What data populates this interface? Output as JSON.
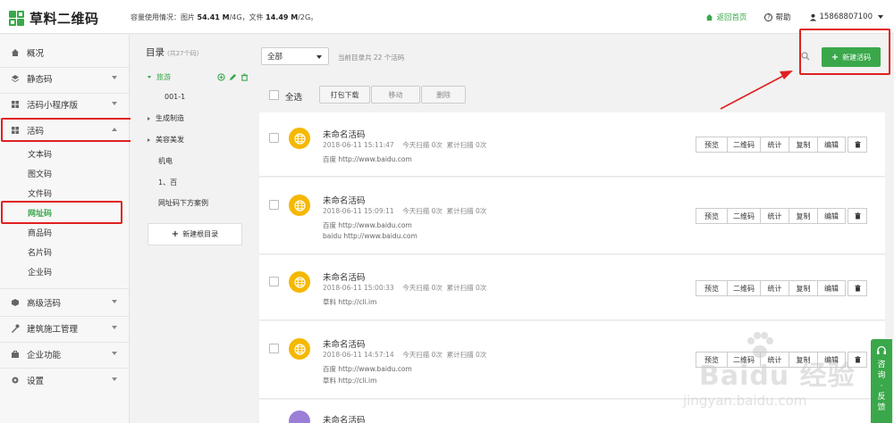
{
  "header": {
    "logo_text": "草料二维码",
    "usage_prefix": "容量使用情况：图片",
    "usage_img": "54.41 M",
    "usage_img_total": "/4G，文件",
    "usage_file": "14.49 M",
    "usage_file_total": "/2G。",
    "home_link": "返回首页",
    "help_link": "帮助",
    "user": "15868807100"
  },
  "sidebar": {
    "items": [
      {
        "label": "概况",
        "icon": "home-icon"
      },
      {
        "label": "静态码",
        "icon": "layers-icon"
      },
      {
        "label": "活码小程序版",
        "icon": "grid-icon"
      },
      {
        "label": "活码",
        "icon": "grid-icon"
      },
      {
        "label": "高级活码",
        "icon": "cube-icon"
      },
      {
        "label": "建筑施工管理",
        "icon": "tools-icon"
      },
      {
        "label": "企业功能",
        "icon": "briefcase-icon"
      },
      {
        "label": "设置",
        "icon": "gear-icon"
      }
    ],
    "sub_items": [
      "文本码",
      "图文码",
      "文件码",
      "网址码",
      "商品码",
      "名片码",
      "企业码"
    ]
  },
  "directory": {
    "title": "目录",
    "count": "(共27个码)",
    "nodes": [
      "旅游",
      "001-1",
      "生成制造",
      "美容美发",
      "机电",
      "1、百",
      "网址码下方案例"
    ],
    "new_dir_label": "新建根目录"
  },
  "main": {
    "filter_value": "全部",
    "count_text": "当前目录共 22 个活码",
    "new_button": "新建活码",
    "select_all": "全选",
    "toolbar": [
      "打包下载",
      "移动",
      "删除"
    ],
    "actions": [
      "预览",
      "二维码",
      "统计",
      "复制",
      "编辑"
    ],
    "cards": [
      {
        "title": "未命名活码",
        "meta": "2018-06-11 15:11:47    今天扫描 0次  累计扫描 0次",
        "lines": [
          "百度 http://www.baidu.com"
        ]
      },
      {
        "title": "未命名活码",
        "meta": "2018-06-11 15:09:11    今天扫描 0次  累计扫描 0次",
        "lines": [
          "百度 http://www.baidu.com",
          "baidu http://www.baidu.com"
        ]
      },
      {
        "title": "未命名活码",
        "meta": "2018-06-11 15:00:33    今天扫描 0次  累计扫描 0次",
        "lines": [
          "草料 http://cli.im"
        ]
      },
      {
        "title": "未命名活码",
        "meta": "2018-06-11 14:57:14    今天扫描 0次  累计扫描 0次",
        "lines": [
          "百度 http://www.baidu.com",
          "草料 http://cli.im"
        ]
      },
      {
        "title": "未命名活码",
        "meta": "",
        "lines": []
      }
    ]
  },
  "consult": {
    "chars": [
      "咨",
      "询",
      "·",
      "反",
      "馈"
    ]
  },
  "watermark": {
    "text": "Baidu 经验",
    "url": "jingyan.baidu.com"
  },
  "colors": {
    "brand": "#3aa84a",
    "annotation": "#e02020",
    "avatar": "#f5b800",
    "avatar_alt": "#9b7fd6"
  }
}
